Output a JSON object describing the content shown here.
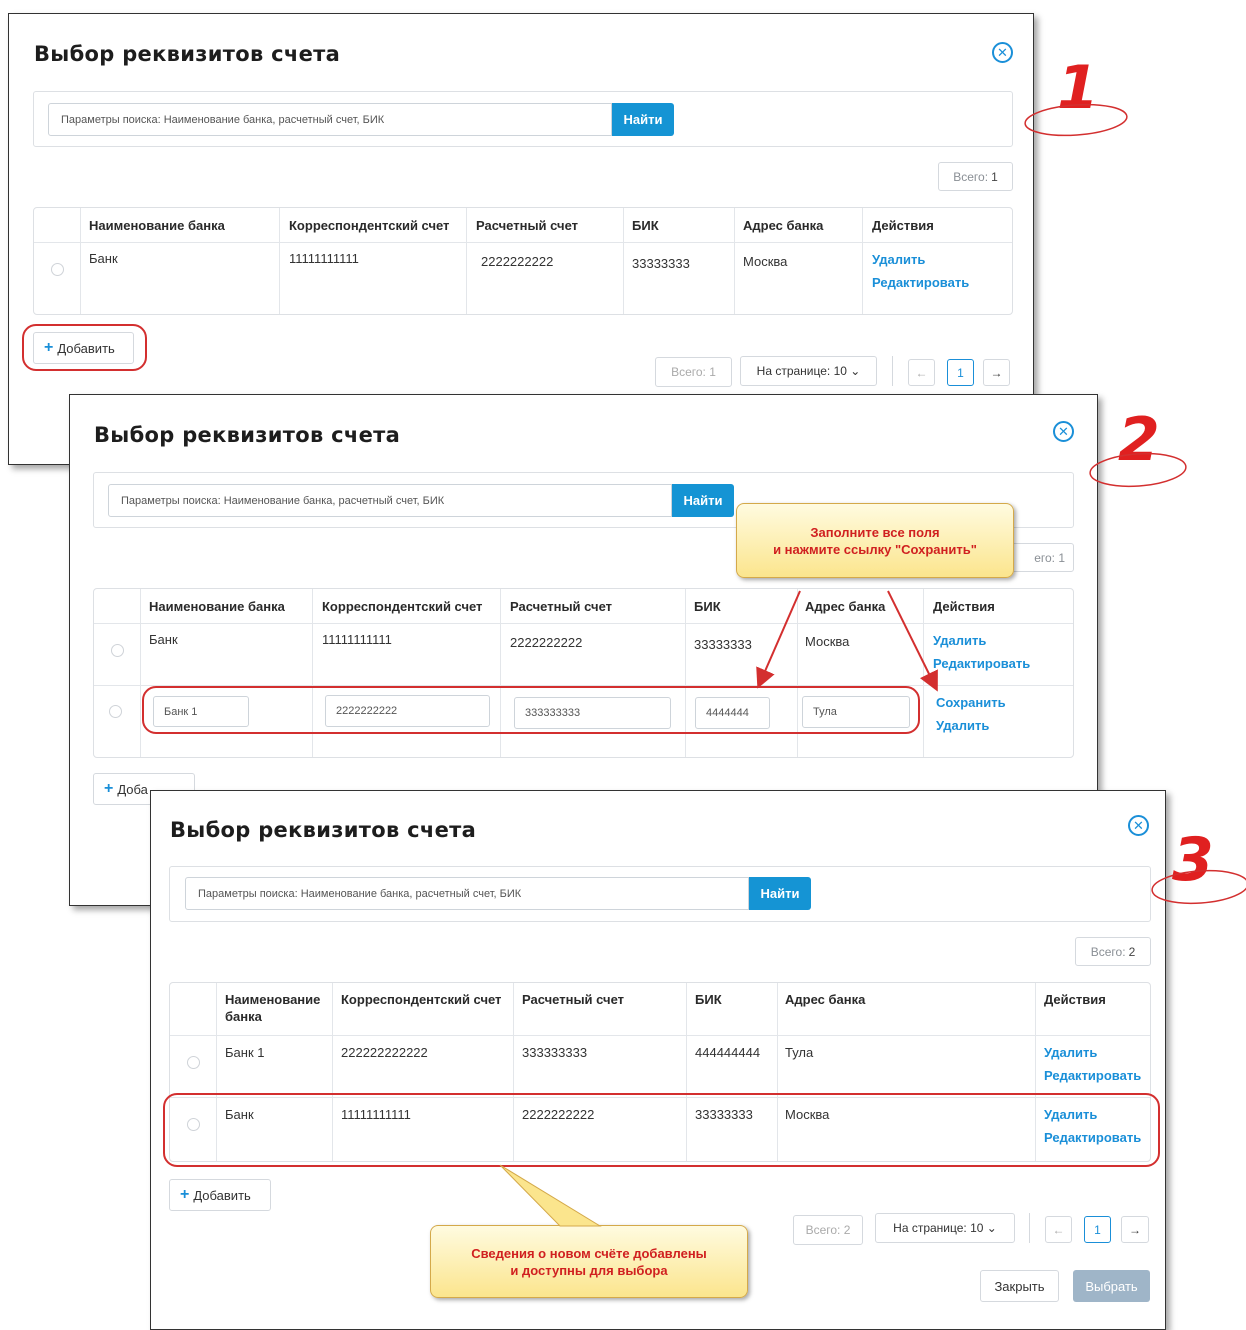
{
  "p1": {
    "title": "Выбор реквизитов счета",
    "search_placeholder": "Параметры поиска: Наименование банка, расчетный счет, БИК",
    "search_btn": "Найти",
    "total_label": "Всего:",
    "total_value": "1",
    "headers": [
      "Наименование банка",
      "Корреспондентский счет",
      "Расчетный счет",
      "БИК",
      "Адрес банка",
      "Действия"
    ],
    "row": [
      "Банк",
      "11111111111",
      "2222222222",
      "33333333",
      "Москва"
    ],
    "delete": "Удалить",
    "edit": "Редактировать",
    "add": "Добавить",
    "pager_total": "Всего: 1",
    "per_page": "На странице: 10 ⌄",
    "prev": "←",
    "page": "1",
    "next": "→"
  },
  "p2": {
    "title": "Выбор реквизитов счета",
    "search_placeholder": "Параметры поиска: Наименование банка, расчетный счет, БИК",
    "search_btn": "Найти",
    "total_partial": "его: 1",
    "headers": [
      "Наименование банка",
      "Корреспондентский счет",
      "Расчетный счет",
      "БИК",
      "Адрес банка",
      "Действия"
    ],
    "row": [
      "Банк",
      "11111111111",
      "2222222222",
      "33333333",
      "Москва"
    ],
    "inputs": [
      "Банк 1",
      "2222222222",
      "333333333",
      "4444444",
      "Тула"
    ],
    "delete": "Удалить",
    "edit": "Редактировать",
    "save": "Сохранить",
    "add_partial": "Доба"
  },
  "p3": {
    "title": "Выбор реквизитов счета",
    "search_placeholder": "Параметры поиска: Наименование банка, расчетный счет, БИК",
    "search_btn": "Найти",
    "total_label": "Всего:",
    "total_value": "2",
    "headers": [
      "Наименование банка",
      "Корреспондентский счет",
      "Расчетный счет",
      "БИК",
      "Адрес банка",
      "Действия"
    ],
    "row1": [
      "Банк 1",
      "222222222222",
      "333333333",
      "444444444",
      "Тула"
    ],
    "row2": [
      "Банк",
      "11111111111",
      "2222222222",
      "33333333",
      "Москва"
    ],
    "delete": "Удалить",
    "edit": "Редактировать",
    "add": "Добавить",
    "pager_total": "Всего: 2",
    "per_page": "На странице: 10 ⌄",
    "prev": "←",
    "page": "1",
    "next": "→",
    "close_btn": "Закрыть",
    "select_btn": "Выбрать"
  },
  "callout1": {
    "line1": "Заполните все поля",
    "line2": "и нажмите ссылку \"Сохранить\""
  },
  "callout2": {
    "line1": "Сведения о новом счёте добавлены",
    "line2": "и доступны для выбора"
  },
  "steps": [
    "1",
    "2",
    "3"
  ],
  "colors": {
    "accent": "#1594d4",
    "annotation": "#d32f2f",
    "callout_bg": "#fbe58d"
  }
}
